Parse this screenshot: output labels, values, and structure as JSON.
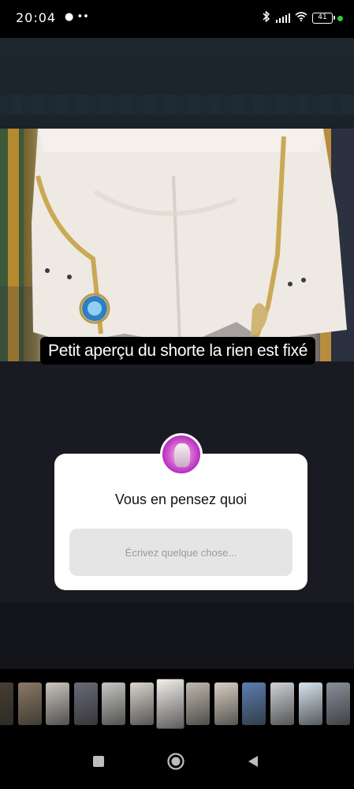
{
  "status_bar": {
    "time": "20:04",
    "left_icons": "● ••",
    "battery_level": "41",
    "bluetooth_icon": "bluetooth-icon",
    "signal_icon": "signal-icon",
    "wifi_icon": "wifi-icon"
  },
  "story": {
    "caption": "Petit aperçu du shorte la rien est fixé",
    "question_sticker": {
      "prompt": "Vous en pensez quoi",
      "answer_placeholder": "Écrivez quelque chose..."
    }
  },
  "thumbnails": {
    "count": 13,
    "active_index": 6,
    "colors": [
      "#4a3f34",
      "#8a7a66",
      "#c9c4bd",
      "#6a6a78",
      "#c8c6c2",
      "#d9d4cc",
      "#f2efec",
      "#bfb8ae",
      "#d8cfc4",
      "#5c7fb0",
      "#cfd2d6",
      "#d6e4ef",
      "#8a8f9a"
    ]
  },
  "nav_bar": {
    "recents_icon": "recents-square-icon",
    "home_icon": "home-circle-icon",
    "back_icon": "back-triangle-icon"
  },
  "colors": {
    "accent_green": "#2ecc40",
    "card_bg": "#ffffff",
    "field_bg": "#e5e5e5"
  }
}
